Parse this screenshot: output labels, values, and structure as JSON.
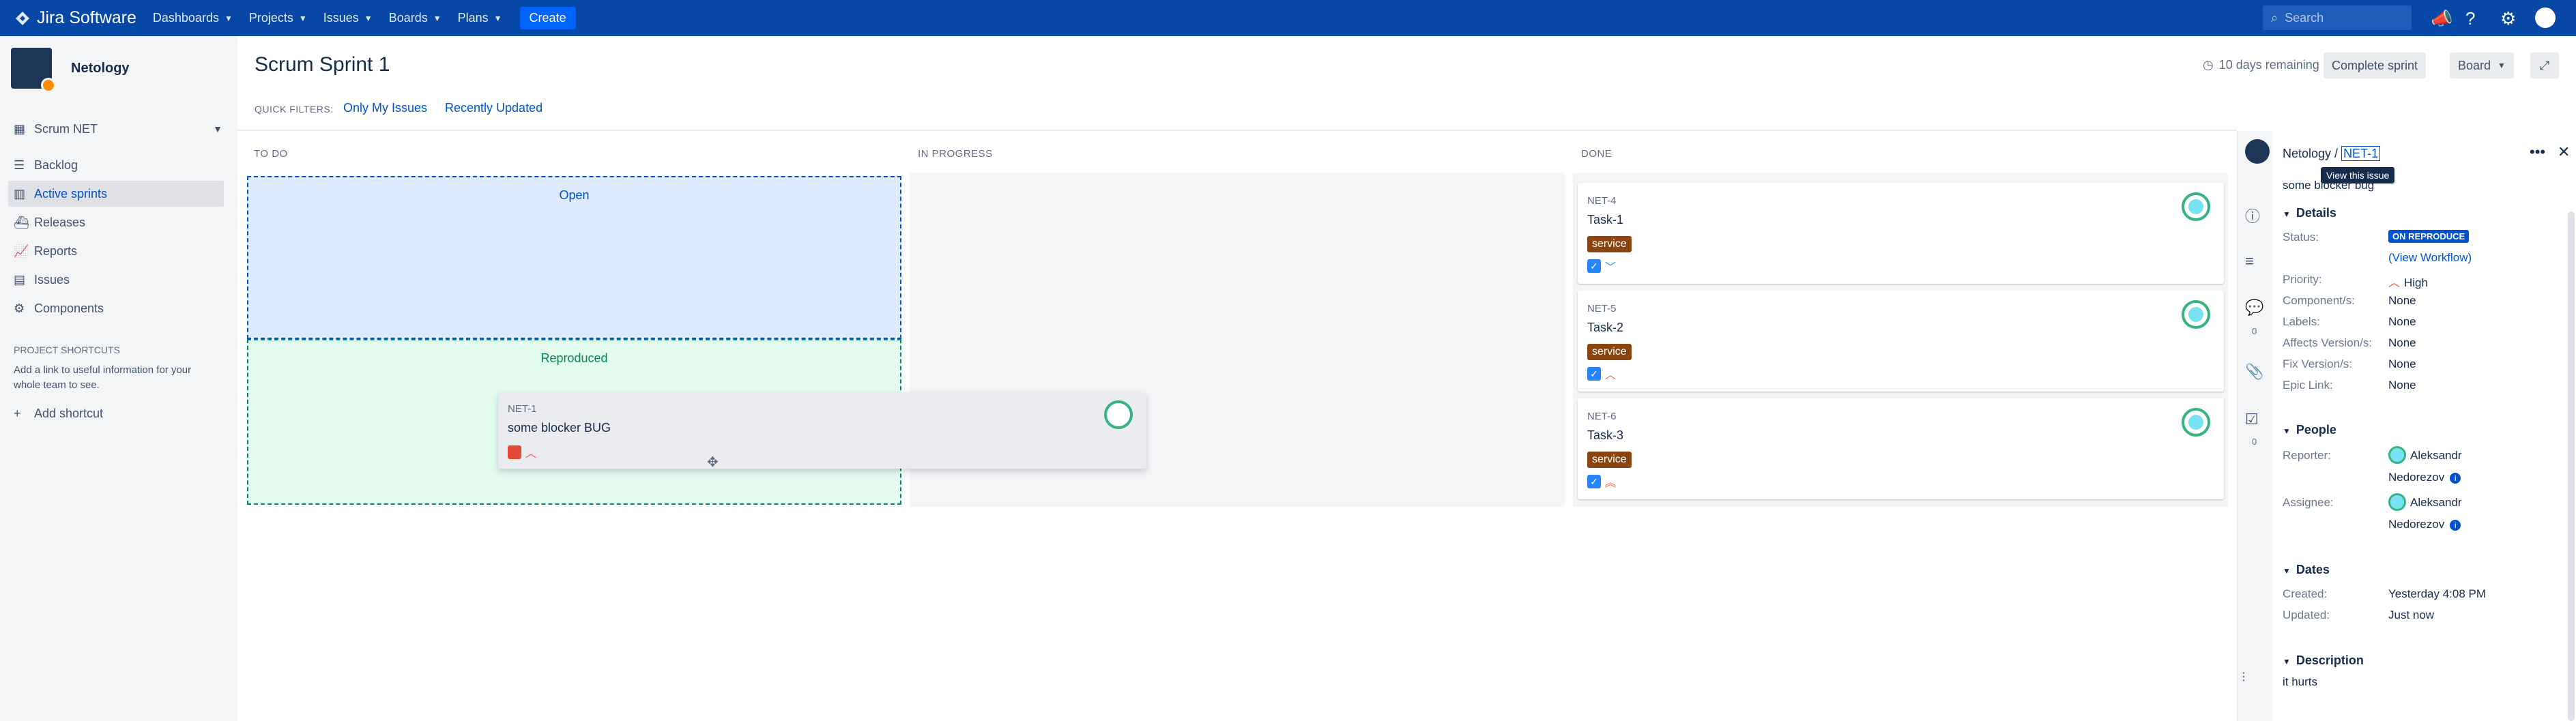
{
  "topnav": {
    "product": "Jira Software",
    "items": [
      "Dashboards",
      "Projects",
      "Issues",
      "Boards",
      "Plans"
    ],
    "create": "Create",
    "search_placeholder": "Search"
  },
  "sidebar": {
    "project_name": "Netology",
    "board_selector": "Scrum NET",
    "items": [
      "Backlog",
      "Active sprints",
      "Releases",
      "Reports",
      "Issues",
      "Components"
    ],
    "shortcuts_heading": "PROJECT SHORTCUTS",
    "shortcuts_desc": "Add a link to useful information for your whole team to see.",
    "add_shortcut": "Add shortcut"
  },
  "header": {
    "title": "Scrum Sprint 1",
    "quick_filters_label": "QUICK FILTERS:",
    "quick_filters": [
      "Only My Issues",
      "Recently Updated"
    ],
    "remaining": "10 days remaining",
    "complete": "Complete sprint",
    "board": "Board"
  },
  "columns": [
    "TO DO",
    "IN PROGRESS",
    "DONE"
  ],
  "drop_zones": {
    "open": "Open",
    "reproduced": "Reproduced"
  },
  "dragging_card": {
    "key": "NET-1",
    "summary": "some blocker BUG"
  },
  "done_cards": [
    {
      "key": "NET-4",
      "summary": "Task-1",
      "epic": "service"
    },
    {
      "key": "NET-5",
      "summary": "Task-2",
      "epic": "service"
    },
    {
      "key": "NET-6",
      "summary": "Task-3",
      "epic": "service"
    }
  ],
  "panel": {
    "breadcrumb_project": "Netology /",
    "breadcrumb_key": "NET-1",
    "tooltip": "View this issue",
    "summary": "some blocker bug",
    "details_heading": "Details",
    "status_label": "Status:",
    "status_value": "ON REPRODUCE",
    "view_workflow": "(View Workflow)",
    "priority_label": "Priority:",
    "priority_value": "High",
    "components_label": "Component/s:",
    "components_value": "None",
    "labels_label": "Labels:",
    "labels_value": "None",
    "affects_label": "Affects Version/s:",
    "affects_value": "None",
    "fix_label": "Fix Version/s:",
    "fix_value": "None",
    "epic_label": "Epic Link:",
    "epic_value": "None",
    "people_heading": "People",
    "reporter_label": "Reporter:",
    "reporter_first": "Aleksandr",
    "reporter_last": "Nedorezov",
    "assignee_label": "Assignee:",
    "assignee_first": "Aleksandr",
    "assignee_last": "Nedorezov",
    "dates_heading": "Dates",
    "created_label": "Created:",
    "created_value": "Yesterday 4:08 PM",
    "updated_label": "Updated:",
    "updated_value": "Just now",
    "description_heading": "Description",
    "description": "it hurts",
    "comments_count": "0",
    "subtasks_count": "0"
  }
}
